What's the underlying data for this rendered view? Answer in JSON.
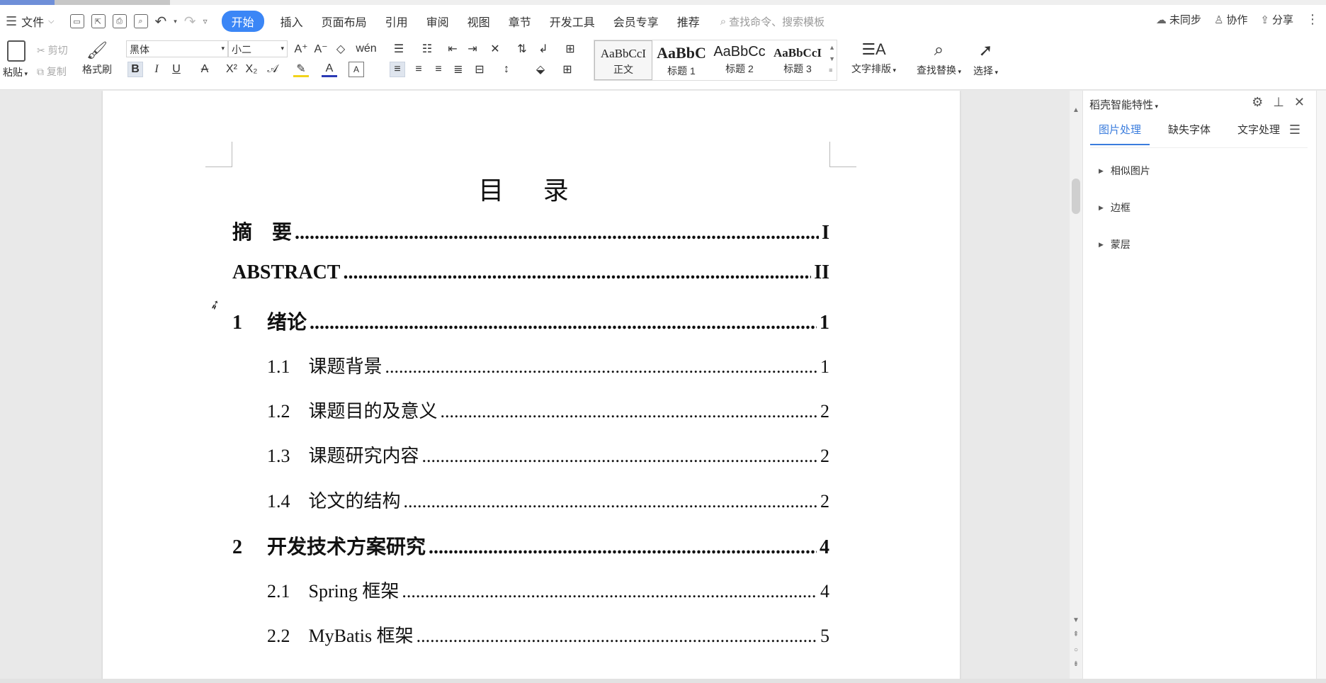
{
  "menubar": {
    "file_label": "文件",
    "tabs": [
      {
        "label": "开始",
        "active": true
      },
      {
        "label": "插入"
      },
      {
        "label": "页面布局"
      },
      {
        "label": "引用"
      },
      {
        "label": "审阅"
      },
      {
        "label": "视图"
      },
      {
        "label": "章节"
      },
      {
        "label": "开发工具"
      },
      {
        "label": "会员专享"
      },
      {
        "label": "推荐"
      }
    ],
    "search_placeholder": "查找命令、搜索模板",
    "right": {
      "sync": "未同步",
      "collab": "协作",
      "share": "分享"
    }
  },
  "ribbon": {
    "paste": "粘贴",
    "cut": "剪切",
    "copy": "复制",
    "format_painter": "格式刷",
    "font_name": "黑体",
    "font_size": "小二",
    "styles": [
      {
        "preview": "AaBbCcI",
        "name": "正文"
      },
      {
        "preview": "AaBbC",
        "name": "标题 1"
      },
      {
        "preview": "AaBbCc",
        "name": "标题 2"
      },
      {
        "preview": "AaBbCcI",
        "name": "标题 3"
      }
    ],
    "text_layout": "文字排版",
    "find_replace": "查找替换",
    "select": "选择"
  },
  "document": {
    "toc_title": "目 录",
    "entries": [
      {
        "label": "摘　要",
        "page": "I",
        "level": 1
      },
      {
        "label": "ABSTRACT",
        "page": "II",
        "level": 1
      },
      {
        "label": "1　 绪论",
        "page": "1",
        "level": 1
      },
      {
        "label": "1.1　课题背景",
        "page": "1",
        "level": 2
      },
      {
        "label": "1.2　课题目的及意义",
        "page": "2",
        "level": 2
      },
      {
        "label": "1.3　课题研究内容",
        "page": "2",
        "level": 2
      },
      {
        "label": "1.4　论文的结构",
        "page": "2",
        "level": 2
      },
      {
        "label": "2　 开发技术方案研究",
        "page": "4",
        "level": 1
      },
      {
        "label": "2.1　Spring 框架",
        "page": "4",
        "level": 2
      },
      {
        "label": "2.2　MyBatis 框架",
        "page": "5",
        "level": 2
      }
    ]
  },
  "panel": {
    "title": "稻壳智能特性",
    "tabs": [
      {
        "label": "图片处理",
        "active": true
      },
      {
        "label": "缺失字体"
      },
      {
        "label": "文字处理"
      }
    ],
    "items": [
      "相似图片",
      "边框",
      "蒙层"
    ]
  }
}
